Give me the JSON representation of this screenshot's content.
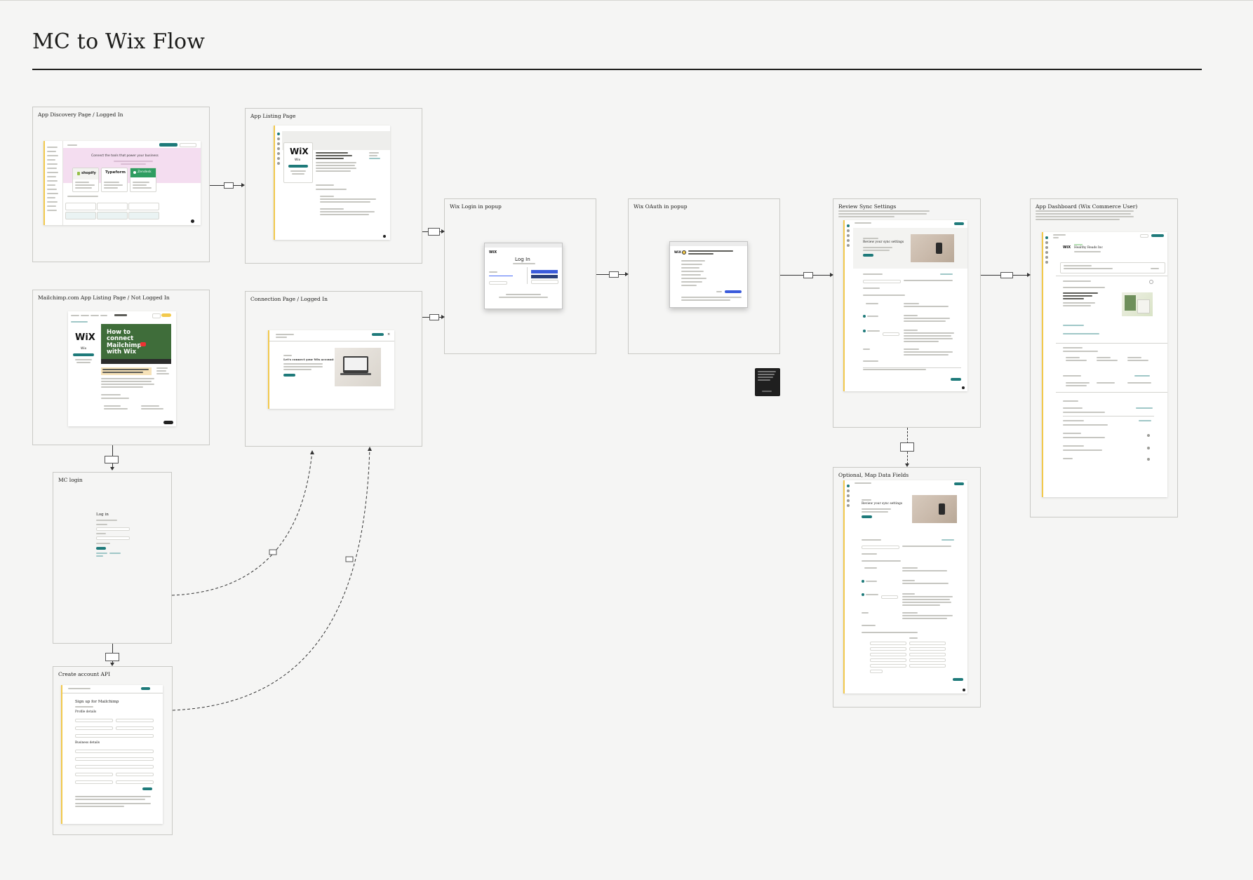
{
  "title": "MC to Wix Flow",
  "frames": {
    "app_discovery": "App Discovery Page / Logged In",
    "app_listing": "App Listing Page",
    "mailchimp_listing": "Mailchimp.com App Listing Page / Not Logged In",
    "connection_page": "Connection Page / Logged In",
    "mc_login": "MC login",
    "create_account": "Create account API",
    "wix_login": "Wix Login in popup",
    "wix_oauth": "Wix OAuth in popup",
    "review_sync": "Review Sync Settings",
    "optional_map": "Optional, Map Data Fields",
    "app_dashboard": "App Dashboard (Wix Commerce User)"
  },
  "screens": {
    "discovery_banner": "Connect the tools that power your business",
    "discovery_apps": [
      "shopify",
      "Typeform",
      "Zendesk"
    ],
    "wix_logo": "WiX",
    "wix_name": "Wix",
    "video_banner": "How to connect Mailchimp with Wix",
    "connect_heading": "Let's connect your Wix account",
    "login_heading": "Log In",
    "mc_login_heading": "Log in",
    "signup_heading": "Sign up for Mailchimp",
    "profile_details": "Profile details",
    "business_details": "Business details",
    "review_heading": "Review your sync settings",
    "dashboard_title": "Healthy Reads Inc",
    "dashboard_wix": "WiX",
    "shopify_icon": "shopify-bag-icon",
    "zendesk_icon": "zendesk-icon",
    "play_icon": "play-icon",
    "laptop_icon": "laptop-icon"
  },
  "colors": {
    "accent_teal": "#1e7a7a",
    "mailchimp_yellow": "#f2c94c",
    "discovery_pink": "#f4ddf0",
    "video_green": "#3f6d3a",
    "wix_blue": "#3b5bdb"
  }
}
